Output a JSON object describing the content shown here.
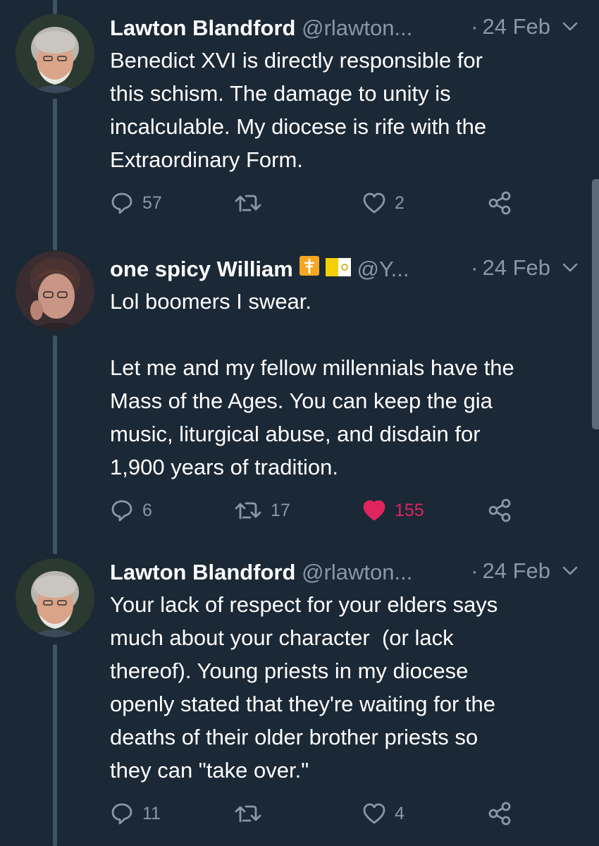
{
  "tweets": [
    {
      "name": "Lawton Blandford",
      "handle": "@rlawton...",
      "date": "24 Feb",
      "text": "Benedict XVI is directly responsible for\nthis schism. The damage to unity is\nincalculable. My diocese is rife with the\nExtraordinary Form.",
      "replies": "57",
      "retweets": "",
      "likes": "2",
      "liked": false
    },
    {
      "name": "one spicy William",
      "handle": "@Y...",
      "date": "24 Feb",
      "text": "Lol boomers I swear.\n\nLet me and my fellow millennials have the\nMass of the Ages. You can keep the gia\nmusic, liturgical abuse, and disdain for\n1,900 years of tradition.",
      "replies": "6",
      "retweets": "17",
      "likes": "155",
      "liked": true,
      "badges": [
        "cross-emoji",
        "vatican-flag-emoji"
      ]
    },
    {
      "name": "Lawton Blandford",
      "handle": "@rlawton...",
      "date": "24 Feb",
      "text": "Your lack of respect for your elders says\nmuch about your character  (or lack\nthereof). Young priests in my diocese\nopenly stated that they're waiting for the\ndeaths of their older brother priests so\nthey can \"take over.\"",
      "replies": "11",
      "retweets": "",
      "likes": "4",
      "liked": false
    }
  ],
  "colors": {
    "background": "#1b2836",
    "secondary_text": "#8899a6",
    "like_active": "#e0245e",
    "thread_line": "#3d5466"
  },
  "icons": {
    "reply": "reply-icon",
    "retweet": "retweet-icon",
    "like": "heart-icon",
    "share": "share-icon",
    "menu": "chevron-down-icon"
  }
}
